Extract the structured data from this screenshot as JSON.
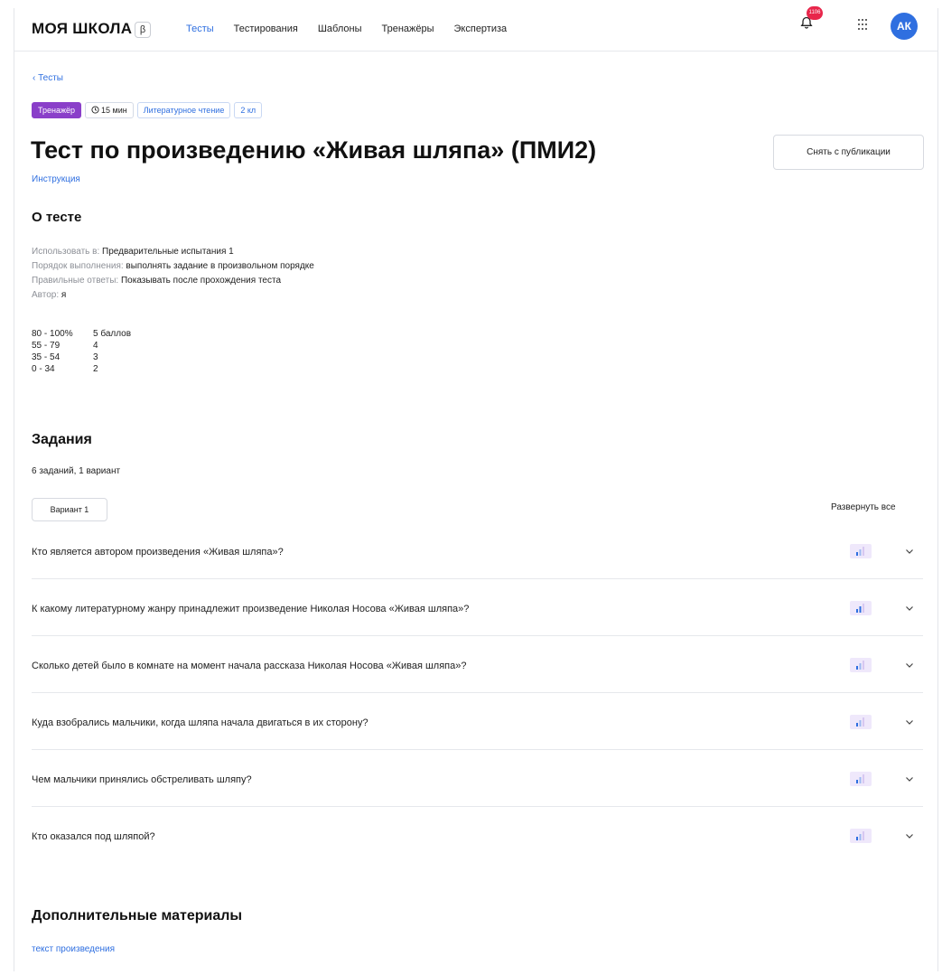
{
  "header": {
    "logo": "МОЯ ШКОЛА",
    "beta": "β",
    "nav": [
      "Тесты",
      "Тестирования",
      "Шаблоны",
      "Тренажёры",
      "Экспертиза"
    ],
    "notifications": "1106",
    "avatar": "АК",
    "accent": "#2f6fe0"
  },
  "breadcrumb": {
    "back": "‹  Тесты"
  },
  "tags": {
    "type": "Тренажёр",
    "time": "15 мин",
    "subject": "Литературное чтение",
    "grade": "2 кл"
  },
  "page": {
    "title": "Тест по произведению «Живая шляпа» (ПМИ2)",
    "unpublish": "Снять с публикации",
    "instruction": "Инструкция"
  },
  "about": {
    "heading": "О тесте",
    "rows": [
      {
        "k": "Использовать в:",
        "v": "Предварительные испытания 1"
      },
      {
        "k": "Порядок выполнения:",
        "v": "выполнять задание в произвольном порядке"
      },
      {
        "k": "Правильные ответы:",
        "v": "Показывать после прохождения теста"
      },
      {
        "k": "Автор:",
        "v": "я"
      }
    ],
    "grades": [
      {
        "range": "80 - 100%",
        "score": "5 баллов"
      },
      {
        "range": "55 - 79",
        "score": "4"
      },
      {
        "range": "35 - 54",
        "score": "3"
      },
      {
        "range": "0 - 34",
        "score": "2"
      }
    ]
  },
  "tasks": {
    "heading": "Задания",
    "count": "6 заданий, 1 вариант",
    "variant": "Вариант 1",
    "expand_all": "Развернуть все",
    "items": [
      {
        "text": "Кто является автором произведения «Живая шляпа»?",
        "level": 1
      },
      {
        "text": "К какому литературному жанру принадлежит произведение Николая Носова «Живая шляпа»?",
        "level": 2
      },
      {
        "text": "Сколько детей было в комнате на момент начала рассказа Николая Носова «Живая шляпа»?",
        "level": 1
      },
      {
        "text": "Куда взобрались мальчики, когда шляпа начала двигаться в их сторону?",
        "level": 1
      },
      {
        "text": "Чем мальчики принялись обстреливать шляпу?",
        "level": 1
      },
      {
        "text": "Кто оказался под шляпой?",
        "level": 1
      }
    ]
  },
  "materials": {
    "heading": "Дополнительные материалы",
    "link": "текст произведения"
  }
}
